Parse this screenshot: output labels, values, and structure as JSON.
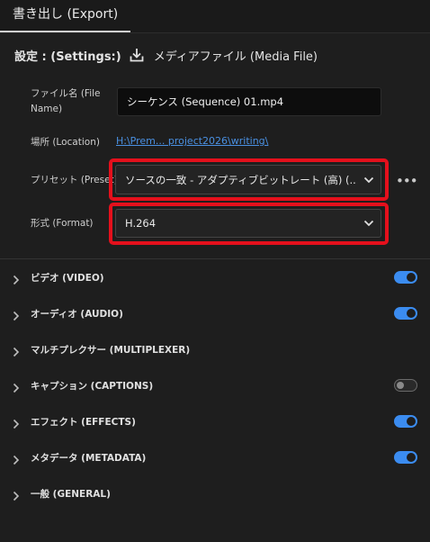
{
  "tab": {
    "label": "書き出し (Export)"
  },
  "settings": {
    "label": "設定 : (Settings:)",
    "icon": "download-icon",
    "value": "メディアファイル (Media File)"
  },
  "file_name": {
    "label_line1": "ファイル名 (File",
    "label_line2": "Name)",
    "value": "シーケンス (Sequence) 01.mp4"
  },
  "location": {
    "label": "場所 (Location)",
    "value": "H:\\Prem... project2026\\writing\\"
  },
  "preset": {
    "label": "プリセット (Preset)",
    "value": "ソースの一致 - アダプティブビットレート (高) (..."
  },
  "format": {
    "label": "形式 (Format)",
    "value": "H.264"
  },
  "highlight_color": "#e4101c",
  "sections": [
    {
      "label": "ビデオ (VIDEO)",
      "toggle": true
    },
    {
      "label": "オーディオ (AUDIO)",
      "toggle": true
    },
    {
      "label": "マルチプレクサー (MULTIPLEXER)",
      "toggle": null
    },
    {
      "label": "キャプション (CAPTIONS)",
      "toggle": false
    },
    {
      "label": "エフェクト (EFFECTS)",
      "toggle": true
    },
    {
      "label": "メタデータ (METADATA)",
      "toggle": true
    },
    {
      "label": "一般 (GENERAL)",
      "toggle": null
    }
  ]
}
